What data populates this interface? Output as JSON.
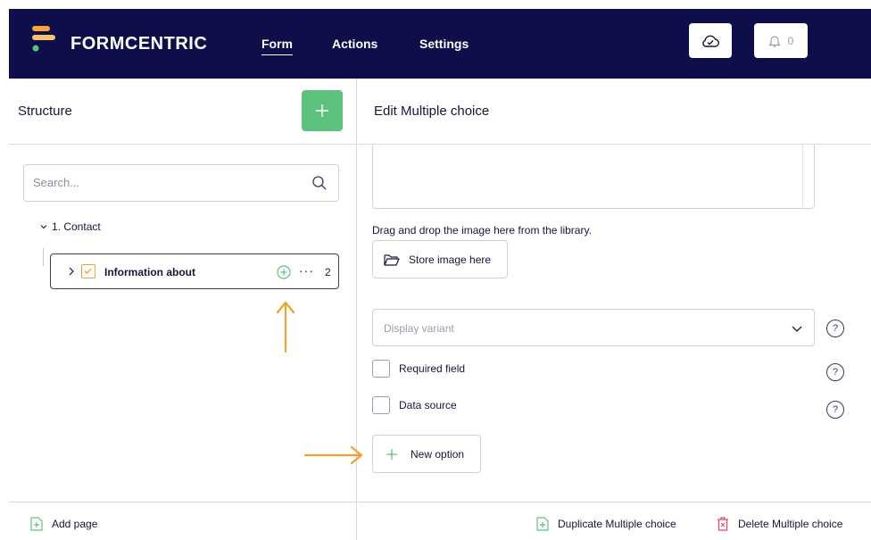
{
  "app": {
    "brand": "FORMCENTRIC",
    "nav": [
      {
        "label": "Form",
        "active": true
      },
      {
        "label": "Actions",
        "active": false
      },
      {
        "label": "Settings",
        "active": false
      }
    ],
    "notifications_count": "0",
    "cloud_icon": "cloud-check-icon",
    "bell_icon": "bell-icon"
  },
  "structure": {
    "title": "Structure",
    "add_icon": "plus-icon",
    "search_placeholder": "Search...",
    "page_label": "1. Contact",
    "item": {
      "label": "Information about",
      "count": "2"
    },
    "footer_add_page": "Add page"
  },
  "editor": {
    "title": "Edit Multiple choice",
    "drag_hint": "Drag and drop the image here from the library.",
    "store_image_label": "Store image here",
    "display_variant_placeholder": "Display variant",
    "required_field_label": "Required field",
    "data_source_label": "Data source",
    "new_option_label": "New option",
    "duplicate_label": "Duplicate Multiple choice",
    "delete_label": "Delete Multiple choice"
  },
  "colors": {
    "topbar": "#0e0f4a",
    "accent_green": "#5ec27f",
    "annotation_orange": "#f0a030",
    "delete_red": "#e0476b"
  }
}
